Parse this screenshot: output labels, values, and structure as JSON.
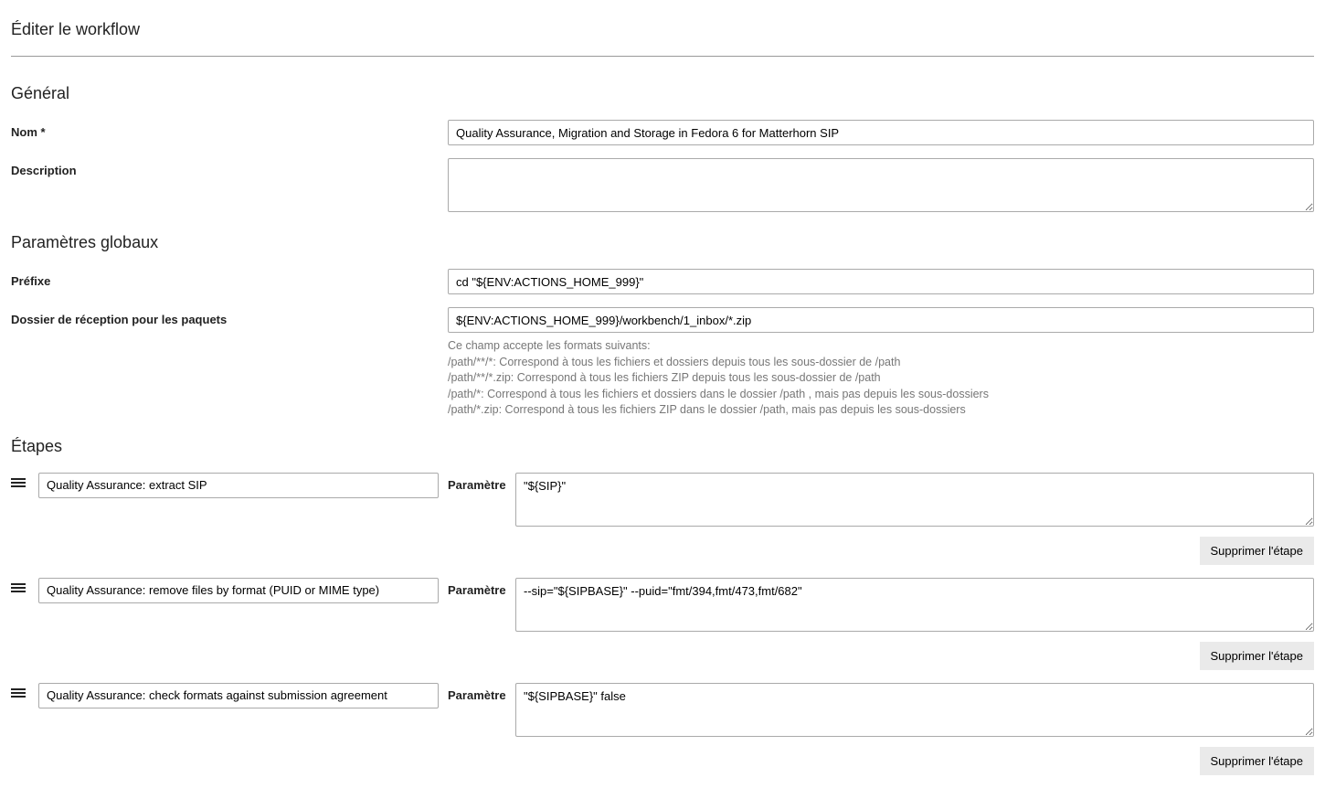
{
  "page_title": "Éditer le workflow",
  "general": {
    "section_title": "Général",
    "name_label": "Nom *",
    "name_value": "Quality Assurance, Migration and Storage in Fedora 6 for Matterhorn SIP",
    "description_label": "Description",
    "description_value": ""
  },
  "globals": {
    "section_title": "Paramètres globaux",
    "prefix_label": "Préfixe",
    "prefix_value": "cd \"${ENV:ACTIONS_HOME_999}\"",
    "inbox_label": "Dossier de réception pour les paquets",
    "inbox_value": "${ENV:ACTIONS_HOME_999}/workbench/1_inbox/*.zip",
    "help_intro": "Ce champ accepte les formats suivants:",
    "help_lines": [
      "/path/**/*: Correspond à tous les fichiers et dossiers depuis tous les sous-dossier de /path",
      "/path/**/*.zip: Correspond à tous les fichiers ZIP depuis tous les sous-dossier de /path",
      "/path/*: Correspond à tous les fichiers et dossiers dans le dossier /path , mais pas depuis les sous-dossiers",
      "/path/*.zip: Correspond à tous les fichiers ZIP dans le dossier /path, mais pas depuis les sous-dossiers"
    ]
  },
  "steps": {
    "section_title": "Étapes",
    "param_label": "Paramètre",
    "delete_label": "Supprimer l'étape",
    "items": [
      {
        "name": "Quality Assurance: extract SIP",
        "param": "\"${SIP}\""
      },
      {
        "name": "Quality Assurance: remove files by format (PUID or MIME type)",
        "param": "--sip=\"${SIPBASE}\" --puid=\"fmt/394,fmt/473,fmt/682\""
      },
      {
        "name": "Quality Assurance: check formats against submission agreement",
        "param": "\"${SIPBASE}\" false"
      }
    ]
  }
}
